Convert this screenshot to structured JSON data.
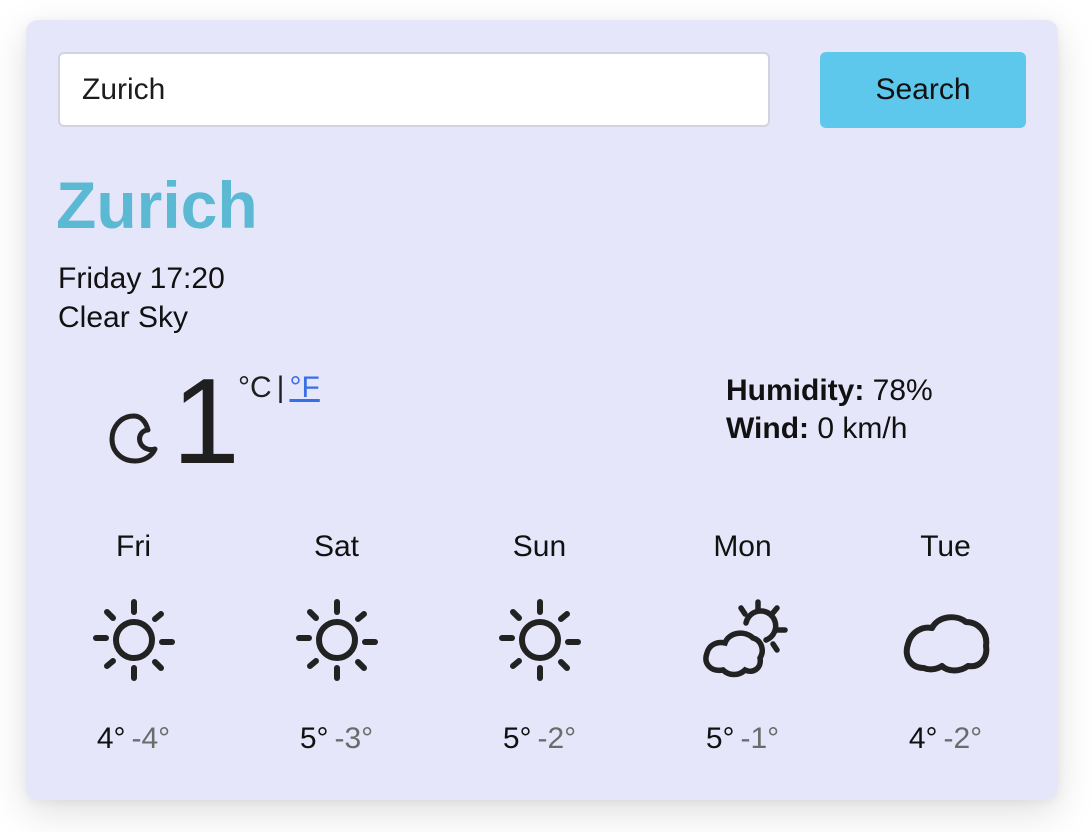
{
  "search": {
    "value": "Zurich",
    "button_label": "Search"
  },
  "current": {
    "city": "Zurich",
    "datetime": "Friday 17:20",
    "description": "Clear Sky",
    "icon": "moon-icon",
    "temperature": "1",
    "unit_celsius": "°C",
    "unit_separator": "|",
    "unit_fahrenheit": "°F",
    "humidity_label": "Humidity:",
    "humidity_value": "78%",
    "wind_label": "Wind:",
    "wind_value": "0 km/h"
  },
  "forecast": [
    {
      "day": "Fri",
      "icon": "sun-icon",
      "max": "4°",
      "min": "-4°"
    },
    {
      "day": "Sat",
      "icon": "sun-icon",
      "max": "5°",
      "min": "-3°"
    },
    {
      "day": "Sun",
      "icon": "sun-icon",
      "max": "5°",
      "min": "-2°"
    },
    {
      "day": "Mon",
      "icon": "partly-cloudy-icon",
      "max": "5°",
      "min": "-1°"
    },
    {
      "day": "Tue",
      "icon": "cloud-icon",
      "max": "4°",
      "min": "-2°"
    }
  ],
  "colors": {
    "card_background": "#e6e6fb",
    "accent": "#5bb9d3",
    "button": "#5ec8ec",
    "link": "#3a6ee8",
    "min_temp": "#6b6b6b"
  }
}
